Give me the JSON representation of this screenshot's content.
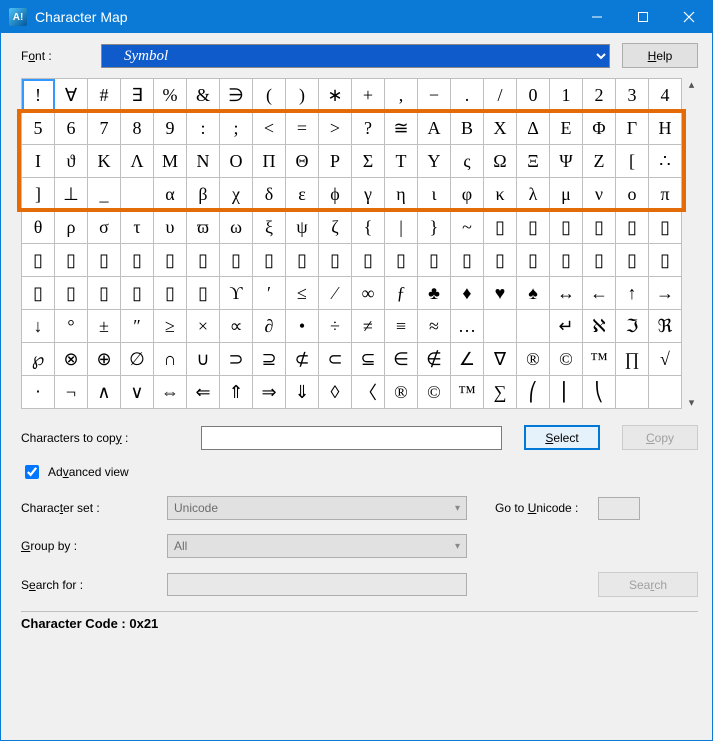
{
  "window": {
    "title": "Character Map",
    "app_icon": "A!"
  },
  "toolbar": {
    "font_label_pre": "F",
    "font_label_pre_u": "o",
    "font_label_post": "nt :",
    "font_value": "Symbol",
    "help_u": "H",
    "help_post": "elp"
  },
  "grid": {
    "cols": 20,
    "rows": 10,
    "selected_index": 0,
    "highlight": {
      "row_start": 1,
      "row_end": 3
    },
    "chars": [
      "!",
      "∀",
      "#",
      "∃",
      "%",
      "&",
      "∋",
      "(",
      ")",
      "∗",
      "+",
      ",",
      "−",
      ".",
      "/",
      "0",
      "1",
      "2",
      "3",
      "4",
      "5",
      "6",
      "7",
      "8",
      "9",
      ":",
      ";",
      "<",
      "=",
      ">",
      "?",
      "≅",
      "Α",
      "Β",
      "Χ",
      "Δ",
      "Ε",
      "Φ",
      "Γ",
      "Η",
      "Ι",
      "ϑ",
      "Κ",
      "Λ",
      "Μ",
      "Ν",
      "Ο",
      "Π",
      "Θ",
      "Ρ",
      "Σ",
      "Τ",
      "Υ",
      "ς",
      "Ω",
      "Ξ",
      "Ψ",
      "Ζ",
      "[",
      "∴",
      "]",
      "⊥",
      "_",
      " ",
      "α",
      "β",
      "χ",
      "δ",
      "ε",
      "ϕ",
      "γ",
      "η",
      "ι",
      "φ",
      "κ",
      "λ",
      "μ",
      "ν",
      "ο",
      "π",
      "θ",
      "ρ",
      "σ",
      "τ",
      "υ",
      "ϖ",
      "ω",
      "ξ",
      "ψ",
      "ζ",
      "{",
      "|",
      "}",
      "~",
      "▯",
      "▯",
      "▯",
      "▯",
      "▯",
      "▯",
      "▯",
      "▯",
      "▯",
      "▯",
      "▯",
      "▯",
      "▯",
      "▯",
      "▯",
      "▯",
      "▯",
      "▯",
      "▯",
      "▯",
      "▯",
      "▯",
      "▯",
      "▯",
      "▯",
      "▯",
      "▯",
      "▯",
      "▯",
      "▯",
      "▯",
      "▯",
      "ϒ",
      "′",
      "≤",
      "⁄",
      "∞",
      "ƒ",
      "♣",
      "♦",
      "♥",
      "♠",
      "↔",
      "←",
      "↑",
      "→",
      "↓",
      "°",
      "±",
      "″",
      "≥",
      "×",
      "∝",
      "∂",
      "•",
      "÷",
      "≠",
      "≡",
      "≈",
      "…",
      "",
      "",
      "↵",
      "ℵ",
      "ℑ",
      "ℜ",
      "℘",
      "⊗",
      "⊕",
      "∅",
      "∩",
      "∪",
      "⊃",
      "⊇",
      "⊄",
      "⊂",
      "⊆",
      "∈",
      "∉",
      "∠",
      "∇",
      "®",
      "©",
      "™",
      "∏",
      "√",
      "⋅",
      "¬",
      "∧",
      "∨",
      "⇔",
      "⇐",
      "⇑",
      "⇒",
      "⇓",
      "◊",
      "〈",
      "®",
      "©",
      "™",
      "∑",
      "⎛",
      "⎜",
      "⎝"
    ]
  },
  "copy": {
    "label_pre": "Characters to cop",
    "label_u": "y",
    "label_post": " :",
    "value": "",
    "select_u": "S",
    "select_post": "elect",
    "copy_u": "C",
    "copy_post": "opy"
  },
  "advanced": {
    "checked": true,
    "label_pre": "Ad",
    "label_u": "v",
    "label_post": "anced view"
  },
  "charset": {
    "label_pre": "Charac",
    "label_u": "t",
    "label_post": "er set :",
    "value": "Unicode",
    "goto_pre": "Go to ",
    "goto_u": "U",
    "goto_post": "nicode :",
    "goto_value": ""
  },
  "groupby": {
    "label_u": "G",
    "label_post": "roup by :",
    "value": "All"
  },
  "search": {
    "label_pre": "S",
    "label_u": "e",
    "label_post": "arch for :",
    "value": "",
    "btn_pre": "Sea",
    "btn_u": "r",
    "btn_post": "ch"
  },
  "status": {
    "text": "Character Code : 0x21"
  }
}
